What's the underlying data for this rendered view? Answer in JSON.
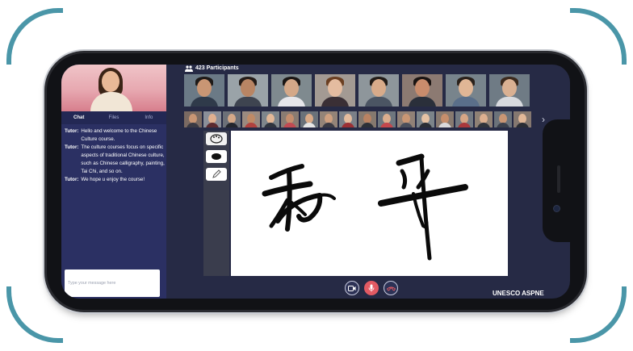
{
  "chat": {
    "tabs": [
      "Chat",
      "Files",
      "Info"
    ],
    "messages": [
      {
        "sender": "Tutor:",
        "text": "Hello and welcome to the Chinese Culture course."
      },
      {
        "sender": "Tutor:",
        "text": "The culture courses focus on specific aspects of traditional Chinese culture, such as Chinese calligraphy, painting, Tai Chi, and so on."
      },
      {
        "sender": "Tutor:",
        "text": "We hope u enjoy the course!"
      }
    ],
    "input_placeholder": "Type your message here"
  },
  "participants": {
    "label": "423 Participants"
  },
  "controls": {
    "icons": [
      "video-camera-icon",
      "microphone-icon",
      "hang-up-icon"
    ],
    "mic_active_color": "#e25a63"
  },
  "watermark": "UNESCO ASPNE",
  "colors": {
    "accent_bracket": "#4a96a8",
    "panel_background": "#2b3063",
    "screen_background": "#262a45"
  }
}
